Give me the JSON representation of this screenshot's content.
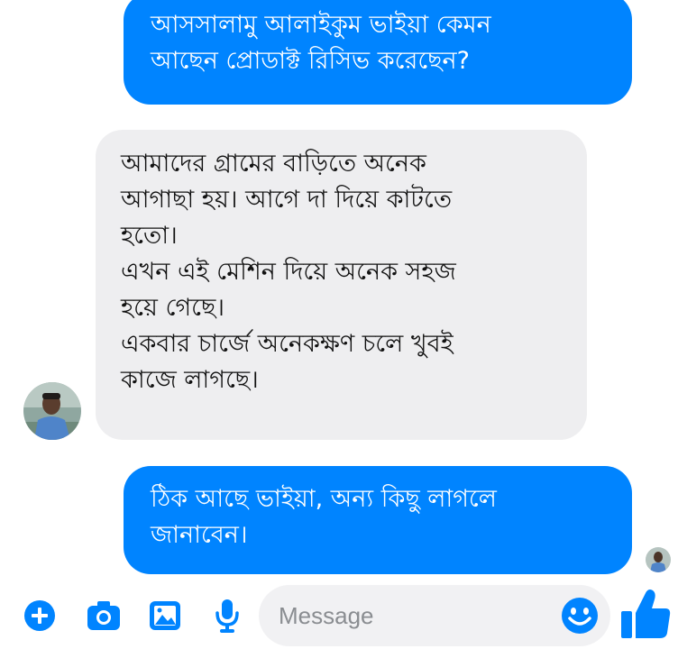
{
  "conversation": {
    "messages": [
      {
        "direction": "sent",
        "text": "আসসালামু আলাইকুম ভাইয়া কেমন\nআছেন প্রোডাক্ট রিসিভ করেছেন?"
      },
      {
        "direction": "received",
        "text": "আমাদের গ্রামের বাড়িতে অনেক\nআগাছা হয়। আগে দা দিয়ে কাটতে\nহতো।\nএখন এই মেশিন দিয়ে অনেক সহজ\nহয়ে গেছে।\nএকবার চার্জে অনেকক্ষণ চলে  খুবই\nকাজে লাগছে।"
      },
      {
        "direction": "sent",
        "text": "ঠিক আছে ভাইয়া, অন্য কিছু লাগলে\nজানাবেন।"
      }
    ]
  },
  "composer": {
    "placeholder": "Message",
    "icons": [
      "plus-icon",
      "camera-icon",
      "gallery-icon",
      "microphone-icon",
      "emoji-icon",
      "thumbs-up-icon"
    ]
  },
  "colors": {
    "accent": "#0084ff",
    "received_bubble": "#eeeef0",
    "input_background": "#f1f1f3"
  }
}
